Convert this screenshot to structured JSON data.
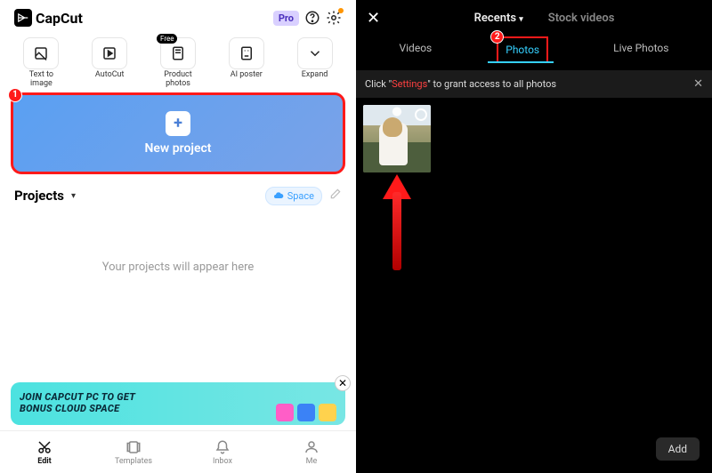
{
  "left": {
    "brand": "CapCut",
    "pro_label": "Pro",
    "free_pill": "Free",
    "tools": [
      {
        "label": "Text to image"
      },
      {
        "label": "AutoCut"
      },
      {
        "label": "Product photos"
      },
      {
        "label": "AI poster"
      },
      {
        "label": "Expand"
      }
    ],
    "new_project": {
      "label": "New project",
      "marker": "1"
    },
    "projects_heading": "Projects",
    "space_label": "Space",
    "empty_hint": "Your projects will appear here",
    "promo_line1": "JOIN CAPCUT PC TO GET",
    "promo_line2": "BONUS CLOUD SPACE",
    "bottom_nav": [
      {
        "label": "Edit"
      },
      {
        "label": "Templates"
      },
      {
        "label": "Inbox"
      },
      {
        "label": "Me"
      }
    ]
  },
  "right": {
    "top_tabs": {
      "recents": "Recents",
      "stock": "Stock videos"
    },
    "sub_tabs": {
      "videos": "Videos",
      "photos": "Photos",
      "live": "Live Photos",
      "marker": "2"
    },
    "alert": {
      "prefix": "Click \"",
      "settings": "Settings",
      "suffix": "\" to grant access to all photos"
    },
    "add_label": "Add"
  }
}
